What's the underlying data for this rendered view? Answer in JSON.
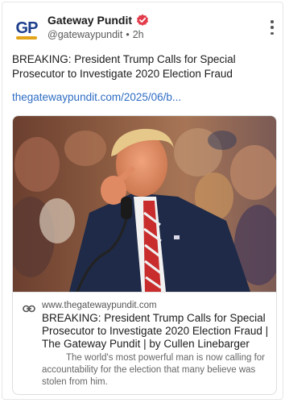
{
  "post": {
    "author": {
      "display_name": "Gateway Pundit",
      "avatar_text": "GP",
      "handle": "@gatewaypundit",
      "separator": "•",
      "time_ago": "2h",
      "verified_icon": "verified-badge-icon"
    },
    "text": "BREAKING: President Trump Calls for Special Prosecutor to Investigate 2020 Election Fraud",
    "link_text": "thegatewaypundit.com/2025/06/b...",
    "link_card": {
      "domain": "www.thegatewaypundit.com",
      "title": "BREAKING: President Trump Calls for Special Prosecutor to Investigate 2020 Election Fraud | The Gateway Pundit | by Cullen Linebarger",
      "description": "The world's most powerful man is now calling for accountability for the election that many believe was stolen from him.",
      "image_description": "man-in-suit-pointing-at-microphone",
      "icon": "link-chain-icon"
    },
    "more_icon": "more-vertical-icon"
  },
  "colors": {
    "brand_blue": "#1d3f8c",
    "brand_gold": "#e3a417",
    "verified_red": "#e23b4a",
    "link_blue": "#2d6cc4"
  }
}
